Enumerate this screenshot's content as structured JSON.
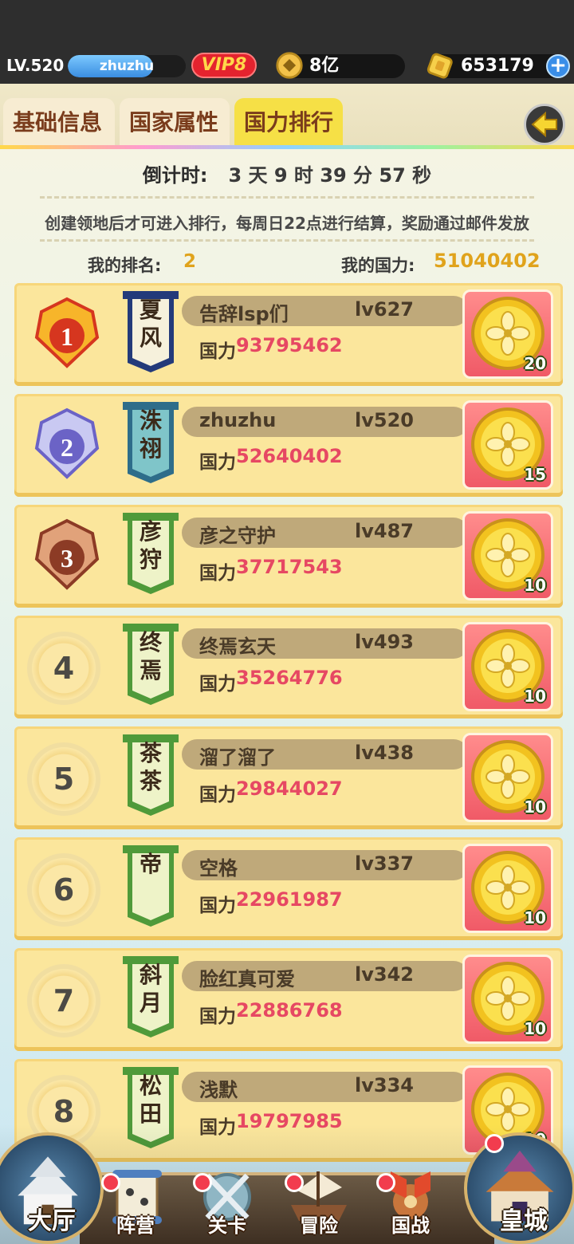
{
  "header": {
    "level": "LV.520",
    "player_name": "zhuzhu",
    "exp_progress": 0.72,
    "vip": "VIP8",
    "silver": "8亿",
    "gold": "653179"
  },
  "tabs": [
    {
      "label": "基础信息",
      "active": false
    },
    {
      "label": "国家属性",
      "active": false
    },
    {
      "label": "国力排行",
      "active": true
    }
  ],
  "info": {
    "countdown_label": "倒计时:",
    "countdown_value": "3 天 9 时 39 分 57 秒",
    "rule": "创建领地后才可进入排行，每周日22点进行结算，奖励通过邮件发放",
    "my_rank_label": "我的排名:",
    "my_rank": "2",
    "my_power_label": "我的国力:",
    "my_power": "51040402"
  },
  "power_label": "国力",
  "rows": [
    {
      "rank": "1",
      "banner": "夏风",
      "name": "告辞lsp们",
      "level": "lv627",
      "power": "93795462",
      "reward": "20",
      "banner_style": "navy"
    },
    {
      "rank": "2",
      "banner": "洙祤",
      "name": "zhuzhu",
      "level": "lv520",
      "power": "52640402",
      "reward": "15",
      "banner_style": "teal"
    },
    {
      "rank": "3",
      "banner": "彦狩",
      "name": "彦之守护",
      "level": "lv487",
      "power": "37717543",
      "reward": "10",
      "banner_style": "green"
    },
    {
      "rank": "4",
      "banner": "终焉",
      "name": "终焉玄天",
      "level": "lv493",
      "power": "35264776",
      "reward": "10",
      "banner_style": "green"
    },
    {
      "rank": "5",
      "banner": "茶茶",
      "name": "溜了溜了",
      "level": "lv438",
      "power": "29844027",
      "reward": "10",
      "banner_style": "green"
    },
    {
      "rank": "6",
      "banner": "帝",
      "name": "空格",
      "level": "lv337",
      "power": "22961987",
      "reward": "10",
      "banner_style": "green"
    },
    {
      "rank": "7",
      "banner": "斜月",
      "name": "脸红真可爱",
      "level": "lv342",
      "power": "22886768",
      "reward": "10",
      "banner_style": "green"
    },
    {
      "rank": "8",
      "banner": "松田",
      "name": "浅默",
      "level": "lv334",
      "power": "19797985",
      "reward": "10",
      "banner_style": "green"
    }
  ],
  "nav": {
    "hall": "大厅",
    "camp": "阵营",
    "stage": "关卡",
    "adventure": "冒险",
    "war": "国战",
    "palace": "皇城"
  },
  "colors": {
    "accent_gold": "#e0a31c",
    "power_red": "#e64863",
    "row_bg": "#fbe69c",
    "vip_red": "#e4232e"
  }
}
